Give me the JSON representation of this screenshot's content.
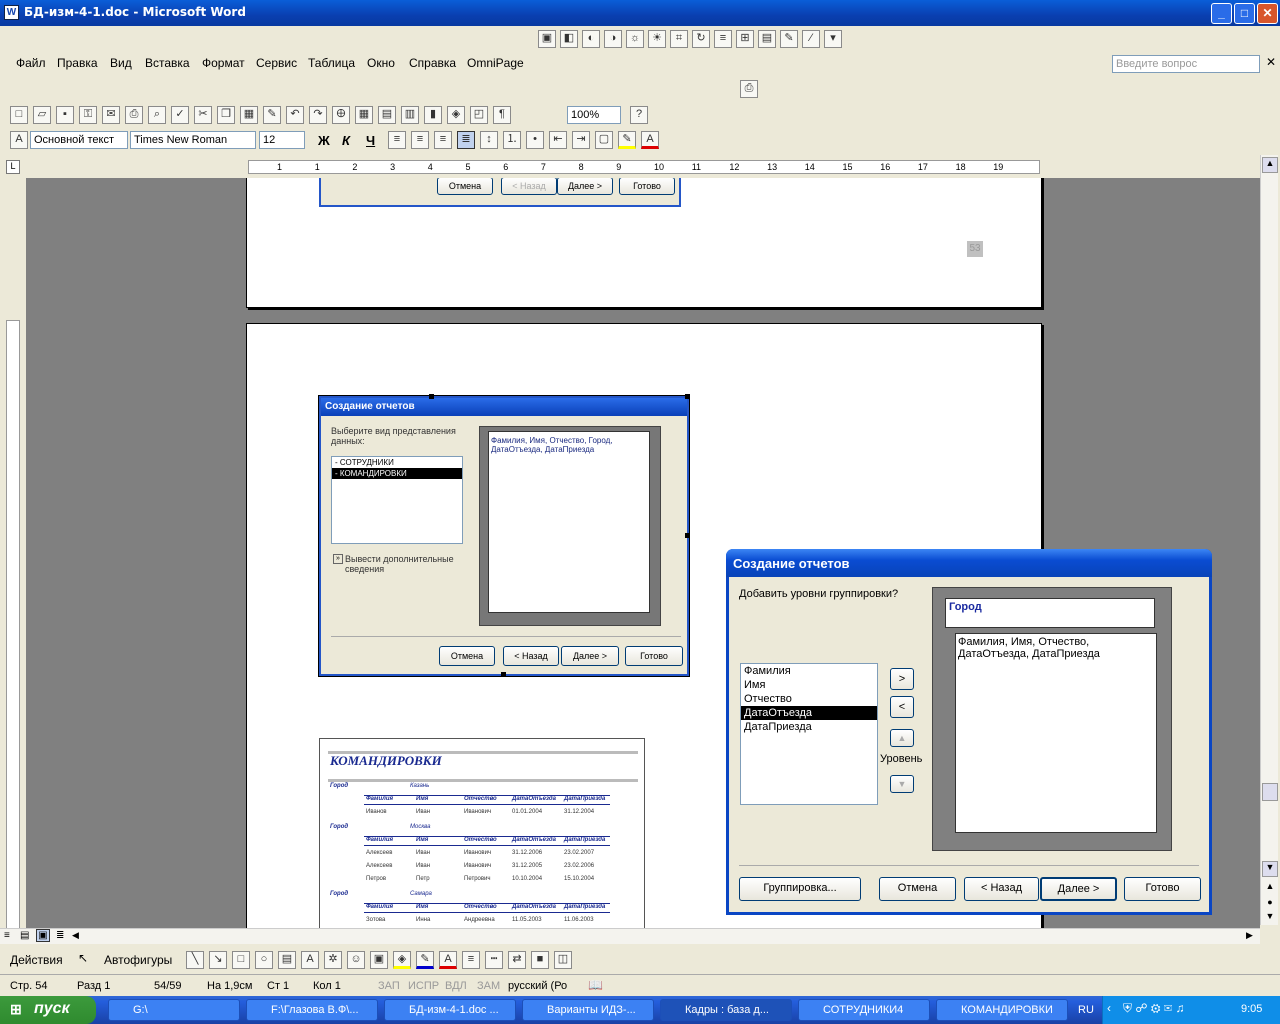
{
  "window": {
    "title": "БД-изм-4-1.doc - Microsoft Word",
    "min": "_",
    "max": "□",
    "close": "✕"
  },
  "menu": [
    "Файл",
    "Правка",
    "Вид",
    "Вставка",
    "Формат",
    "Сервис",
    "Таблица",
    "Окно",
    "Справка",
    "OmniPage"
  ],
  "help": {
    "placeholder": "Введите вопрос"
  },
  "toolbar": {
    "zoom": "100%",
    "style": "Основной текст",
    "font": "Times New Roman",
    "size": "12",
    "bold": "Ж",
    "italic": "К",
    "underline": "Ч"
  },
  "ruler": {
    "numbers": [
      "1",
      "1",
      "2",
      "3",
      "4",
      "5",
      "6",
      "7",
      "8",
      "9",
      "10",
      "11",
      "12",
      "13",
      "14",
      "15",
      "16",
      "17",
      "18",
      "19"
    ]
  },
  "page1": {
    "page_number": "53",
    "buttons": [
      "Отмена",
      "< Назад",
      "Далее >",
      "Готово"
    ]
  },
  "small_dialog": {
    "title": "Создание отчетов",
    "prompt": "Выберите вид представления данных:",
    "items": [
      "- СОТРУДНИКИ",
      "- КОМАНДИРОВКИ"
    ],
    "more": "Вывести дополнительные сведения",
    "preview": "Фамилия, Имя, Отчество, Город, ДатаОтъезда, ДатаПриезда",
    "buttons": [
      "Отмена",
      "< Назад",
      "Далее >",
      "Готово"
    ]
  },
  "report": {
    "title": "КОМАНДИРОВКИ",
    "group_label": "Город",
    "columns": [
      "Фамилия",
      "Имя",
      "Отчество",
      "ДатаОтъезда",
      "ДатаПриезда"
    ],
    "groups": [
      {
        "city": "Казань",
        "rows": [
          [
            "Иванов",
            "Иван",
            "Иванович",
            "01.01.2004",
            "31.12.2004"
          ]
        ]
      },
      {
        "city": "Москва",
        "rows": [
          [
            "Алексеев",
            "Иван",
            "Иванович",
            "31.12.2006",
            "23.02.2007"
          ],
          [
            "Алексеев",
            "Иван",
            "Иванович",
            "31.12.2005",
            "23.02.2006"
          ],
          [
            "Петров",
            "Петр",
            "Петрович",
            "10.10.2004",
            "15.10.2004"
          ]
        ]
      },
      {
        "city": "Самара",
        "rows": [
          [
            "Зотова",
            "Инна",
            "Андреевна",
            "11.05.2003",
            "11.06.2003"
          ]
        ]
      }
    ]
  },
  "big_dialog": {
    "title": "Создание отчетов",
    "prompt": "Добавить уровни группировки?",
    "fields": [
      "Фамилия",
      "Имя",
      "Отчество",
      "ДатаОтъезда",
      "ДатаПриезда"
    ],
    "selected_index": 3,
    "add": ">",
    "remove": "<",
    "level_label": "Уровень",
    "group_header": "Город",
    "group_fields": "Фамилия, Имя, Отчество, ДатаОтъезда, ДатаПриезда",
    "buttons": {
      "grouping": "Группировка...",
      "cancel": "Отмена",
      "back": "< Назад",
      "next": "Далее >",
      "finish": "Готово"
    }
  },
  "drawbar": {
    "actions": "Действия",
    "autoshapes": "Автофигуры"
  },
  "status": {
    "page": "Стр. 54",
    "section": "Разд 1",
    "pages": "54/59",
    "at": "На 1,9см",
    "line": "Ст 1",
    "col": "Кол 1",
    "rec": "ЗАП",
    "trk": "ИСПР",
    "ext": "ВДЛ",
    "ovr": "ЗАМ",
    "lang": "русский (Ро"
  },
  "taskbar": {
    "start": "пуск",
    "tasks": [
      "G:\\",
      "F:\\Глазова В.Ф\\...",
      "БД-изм-4-1.doc ...",
      "Варианты ИДЗ-...",
      "Кадры : база д...",
      "СОТРУДНИКИ4",
      "КОМАНДИРОВКИ"
    ],
    "lang": "RU",
    "time": "9:05"
  }
}
